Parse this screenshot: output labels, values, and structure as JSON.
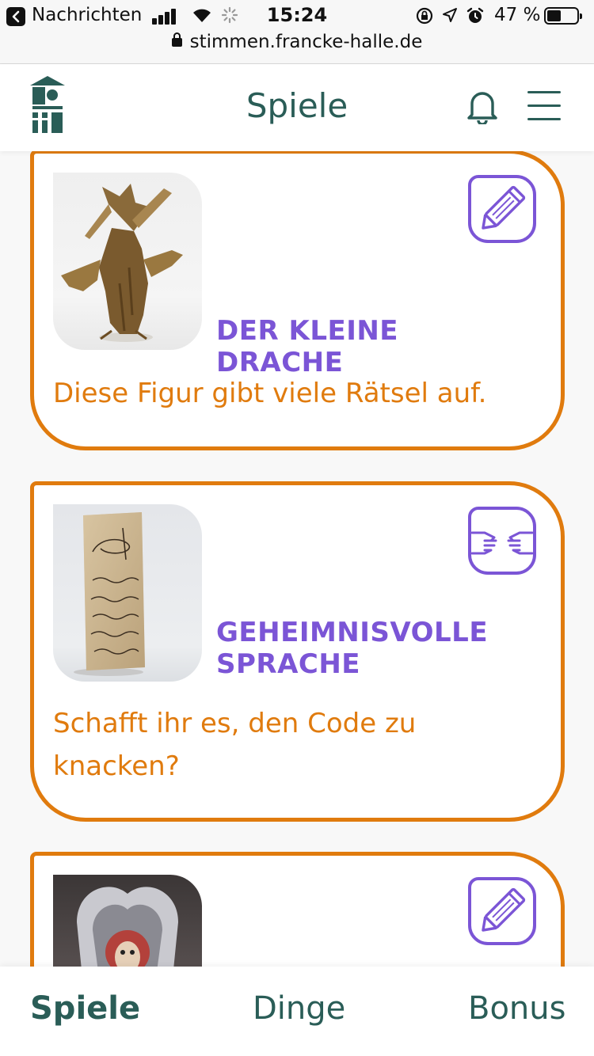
{
  "status_bar": {
    "back_app": "Nachrichten",
    "time": "15:24",
    "battery": "47 %",
    "url": "stimmen.francke-halle.de"
  },
  "header": {
    "title": "Spiele",
    "logo_icon": "francke-house-logo-icon",
    "notification_icon": "bell-icon",
    "menu_icon": "hamburger-menu-icon"
  },
  "cards": [
    {
      "title": "DER KLEINE DRACHE",
      "description": "Diese Figur gibt viele Rätsel auf.",
      "image": "dragon-figure-photo",
      "icon": "pencil-icon"
    },
    {
      "title": "GEHEIMNISVOLLE SPRACHE",
      "description": "Schafft ihr es, den Code zu knacken?",
      "image": "manuscript-document-photo",
      "icon": "sign-language-hands-icon"
    },
    {
      "title": "",
      "description": "",
      "image": "ornate-carved-frame-photo",
      "icon": "pencil-icon"
    }
  ],
  "tabs": [
    {
      "label": "Spiele",
      "active": true
    },
    {
      "label": "Dinge",
      "active": false
    },
    {
      "label": "Bonus",
      "active": false
    }
  ],
  "colors": {
    "primary_green": "#2a5d57",
    "accent_orange": "#e07b0e",
    "accent_purple": "#7b55d6"
  }
}
